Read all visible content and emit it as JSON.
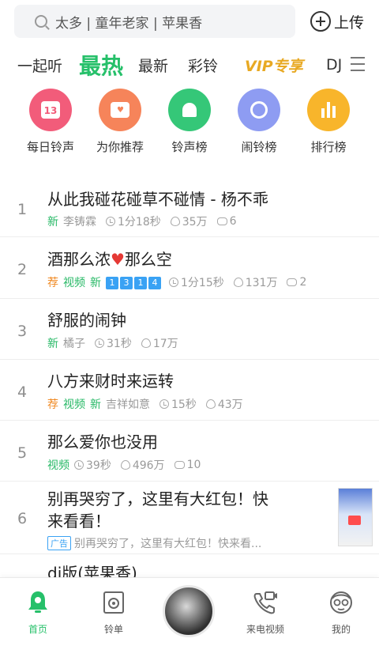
{
  "search": {
    "text": "太多 | 童年老家 | 苹果香"
  },
  "upload": {
    "label": "上传"
  },
  "tabs": [
    {
      "label": "一起听"
    },
    {
      "label": "最热"
    },
    {
      "label": "最新"
    },
    {
      "label": "彩铃"
    },
    {
      "label": "VIP专享"
    },
    {
      "label": "DJ"
    }
  ],
  "categories": [
    {
      "label": "每日铃声",
      "icon": "calendar-icon",
      "color": "#f25c7a",
      "icon_text": "13"
    },
    {
      "label": "为你推荐",
      "icon": "recommend-icon",
      "color": "#f6845a"
    },
    {
      "label": "铃声榜",
      "icon": "bell-icon",
      "color": "#35c778"
    },
    {
      "label": "闹铃榜",
      "icon": "alarm-clock-icon",
      "color": "#8e9cf2"
    },
    {
      "label": "排行榜",
      "icon": "bar-chart-icon",
      "color": "#f8b52b"
    }
  ],
  "songs": [
    {
      "rank": "1",
      "title": "从此我碰花碰草不碰情 - 杨不乖",
      "tags": [
        "新"
      ],
      "author": "李铸霖",
      "duration": "1分18秒",
      "plays": "35万",
      "comments": "6"
    },
    {
      "rank": "2",
      "title_a": "酒那么浓",
      "title_b": "那么空",
      "tags": [
        "荐",
        "视频",
        "新"
      ],
      "badges": [
        "1",
        "3",
        "1",
        "4"
      ],
      "duration": "1分15秒",
      "plays": "131万",
      "comments": "2"
    },
    {
      "rank": "3",
      "title": "舒服的闹钟",
      "tags": [
        "新"
      ],
      "author": "橘子",
      "duration": "31秒",
      "plays": "17万"
    },
    {
      "rank": "4",
      "title": "八方来财时来运转",
      "tags": [
        "荐",
        "视频",
        "新"
      ],
      "author": "吉祥如意",
      "duration": "15秒",
      "plays": "43万"
    },
    {
      "rank": "5",
      "title": "那么爱你也没用",
      "tags": [
        "视频"
      ],
      "duration": "39秒",
      "plays": "496万",
      "comments": "10"
    },
    {
      "rank": "6",
      "title_line1": "别再哭穷了，这里有大红包！快",
      "title_line2": "来看看！",
      "ad_label": "广告",
      "ad_text": "别再哭穷了，这里有大红包！快来看..."
    },
    {
      "title": "dj版(苹果香)"
    }
  ],
  "nav": [
    {
      "label": "首页",
      "icon": "home-bell-icon",
      "active": true
    },
    {
      "label": "铃单",
      "icon": "playlist-icon"
    },
    {
      "label": "来电视频",
      "icon": "video-call-icon"
    },
    {
      "label": "我的",
      "icon": "profile-icon"
    }
  ],
  "colors": {
    "accent": "#26c06a",
    "vip": "#e8a923",
    "recommend": "#f08a24",
    "badge": "#3aa2f4"
  }
}
